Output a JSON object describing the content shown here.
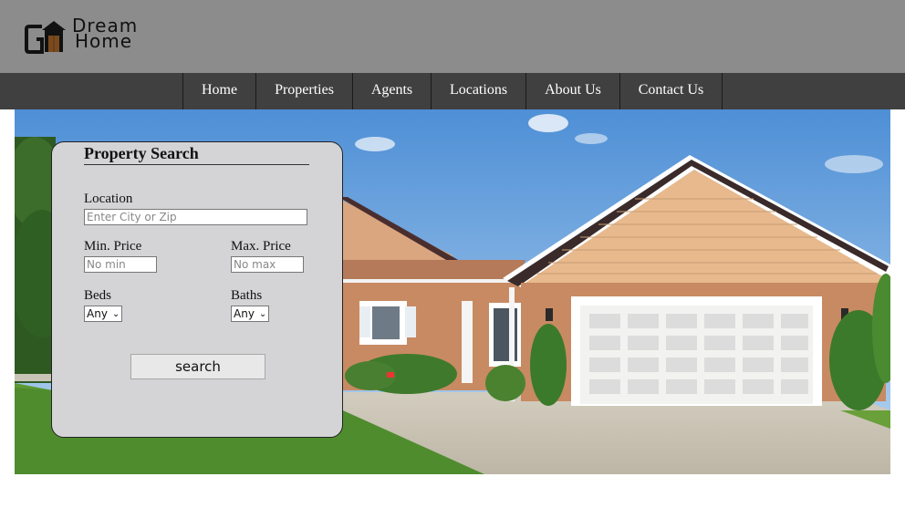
{
  "logo": {
    "line1": "Dream",
    "line2": "Home"
  },
  "nav": {
    "items": [
      "Home",
      "Properties",
      "Agents",
      "Locations",
      "About Us",
      "Contact Us"
    ]
  },
  "search": {
    "title": "Property Search",
    "location_label": "Location",
    "location_placeholder": "Enter City or Zip",
    "min_price_label": "Min. Price",
    "min_price_placeholder": "No min",
    "max_price_label": "Max. Price",
    "max_price_placeholder": "No max",
    "beds_label": "Beds",
    "beds_value": "Any",
    "baths_label": "Baths",
    "baths_value": "Any",
    "button_label": "search"
  },
  "colors": {
    "header_bg": "#8c8c8c",
    "nav_bg": "#404040",
    "panel_bg": "#d4d3d6"
  },
  "icons": {
    "chevron": "chevron-down-icon",
    "logo": "house-logo-icon"
  }
}
